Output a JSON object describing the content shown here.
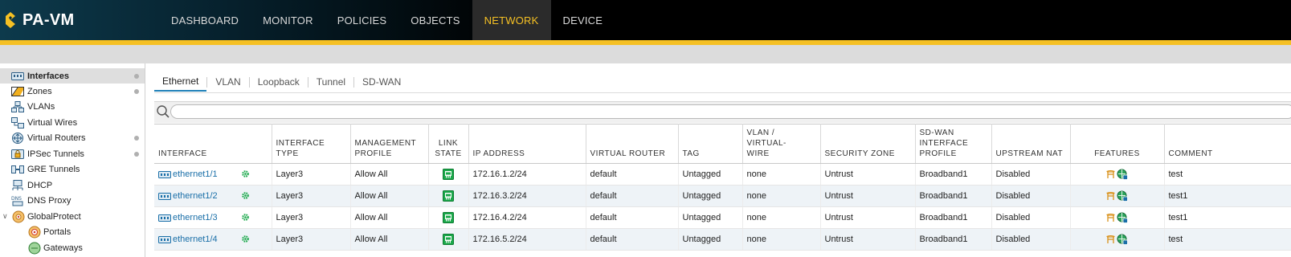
{
  "app": {
    "logo_text": "PA-VM",
    "brand_accent": "#f5c024"
  },
  "nav": {
    "items": [
      {
        "label": "DASHBOARD",
        "active": false
      },
      {
        "label": "MONITOR",
        "active": false
      },
      {
        "label": "POLICIES",
        "active": false
      },
      {
        "label": "OBJECTS",
        "active": false
      },
      {
        "label": "NETWORK",
        "active": true
      },
      {
        "label": "DEVICE",
        "active": false
      }
    ]
  },
  "sidebar": {
    "items": [
      {
        "label": "Interfaces",
        "icon": "interfaces-icon",
        "selected": true,
        "dot": true
      },
      {
        "label": "Zones",
        "icon": "zones-icon",
        "selected": false,
        "dot": true
      },
      {
        "label": "VLANs",
        "icon": "vlans-icon",
        "selected": false,
        "dot": false
      },
      {
        "label": "Virtual Wires",
        "icon": "virtual-wires-icon",
        "selected": false,
        "dot": false
      },
      {
        "label": "Virtual Routers",
        "icon": "virtual-routers-icon",
        "selected": false,
        "dot": true
      },
      {
        "label": "IPSec Tunnels",
        "icon": "ipsec-tunnels-icon",
        "selected": false,
        "dot": true
      },
      {
        "label": "GRE Tunnels",
        "icon": "gre-tunnels-icon",
        "selected": false,
        "dot": false
      },
      {
        "label": "DHCP",
        "icon": "dhcp-icon",
        "selected": false,
        "dot": false
      },
      {
        "label": "DNS Proxy",
        "icon": "dns-proxy-icon",
        "selected": false,
        "dot": false
      },
      {
        "label": "GlobalProtect",
        "icon": "globalprotect-icon",
        "selected": false,
        "dot": false,
        "expanded": true
      },
      {
        "label": "Portals",
        "icon": "portals-icon",
        "selected": false,
        "dot": false,
        "child": true
      },
      {
        "label": "Gateways",
        "icon": "gateways-icon",
        "selected": false,
        "dot": false,
        "child": true
      }
    ],
    "dns_badge": "DNS"
  },
  "tabs": [
    {
      "label": "Ethernet",
      "active": true
    },
    {
      "label": "VLAN",
      "active": false
    },
    {
      "label": "Loopback",
      "active": false
    },
    {
      "label": "Tunnel",
      "active": false
    },
    {
      "label": "SD-WAN",
      "active": false
    }
  ],
  "search": {
    "value": "",
    "placeholder": ""
  },
  "table": {
    "headers": {
      "interface": "INTERFACE",
      "interface_type": "INTERFACE TYPE",
      "mgmt_profile_1": "MANAGEMENT",
      "mgmt_profile_2": "PROFILE",
      "link_state_1": "LINK",
      "link_state_2": "STATE",
      "ip_address": "IP ADDRESS",
      "virtual_router": "VIRTUAL ROUTER",
      "tag": "TAG",
      "vlan_1": "VLAN / VIRTUAL-",
      "vlan_2": "WIRE",
      "security_zone": "SECURITY ZONE",
      "sdwan_1": "SD-WAN",
      "sdwan_2": "INTERFACE",
      "sdwan_3": "PROFILE",
      "upstream_nat": "UPSTREAM NAT",
      "features": "FEATURES",
      "comment": "COMMENT"
    },
    "rows": [
      {
        "interface": "ethernet1/1",
        "type": "Layer3",
        "mgmt": "Allow All",
        "ip": "172.16.1.2/24",
        "vr": "default",
        "tag": "Untagged",
        "vlan": "none",
        "zone": "Untrust",
        "sdwan": "Broadband1",
        "nat": "Disabled",
        "comment": "test"
      },
      {
        "interface": "ethernet1/2",
        "type": "Layer3",
        "mgmt": "Allow All",
        "ip": "172.16.3.2/24",
        "vr": "default",
        "tag": "Untagged",
        "vlan": "none",
        "zone": "Untrust",
        "sdwan": "Broadband1",
        "nat": "Disabled",
        "comment": "test1"
      },
      {
        "interface": "ethernet1/3",
        "type": "Layer3",
        "mgmt": "Allow All",
        "ip": "172.16.4.2/24",
        "vr": "default",
        "tag": "Untagged",
        "vlan": "none",
        "zone": "Untrust",
        "sdwan": "Broadband1",
        "nat": "Disabled",
        "comment": "test1"
      },
      {
        "interface": "ethernet1/4",
        "type": "Layer3",
        "mgmt": "Allow All",
        "ip": "172.16.5.2/24",
        "vr": "default",
        "tag": "Untagged",
        "vlan": "none",
        "zone": "Untrust",
        "sdwan": "Broadband1",
        "nat": "Disabled",
        "comment": "test"
      }
    ],
    "link_state_color": "#1aa84a",
    "link_color": "#1a6fa8"
  }
}
